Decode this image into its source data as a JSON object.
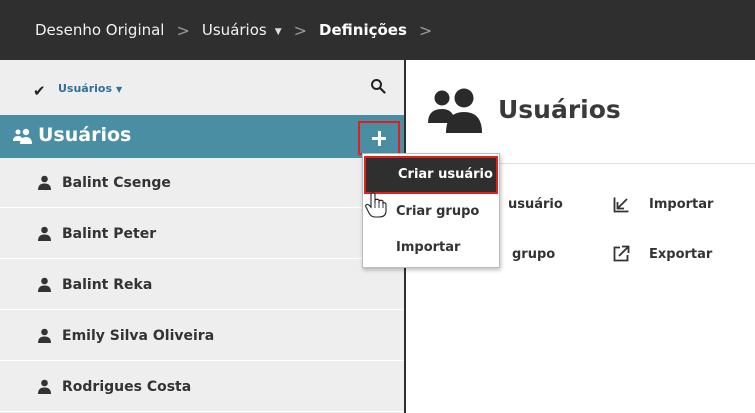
{
  "breadcrumb": {
    "items": [
      "Desenho Original",
      "Usuários",
      "Definições"
    ],
    "separator": ">"
  },
  "sidebar": {
    "filter_label": "Usuários",
    "group_title": "Usuários",
    "users": [
      "Balint Csenge",
      "Balint Peter",
      "Balint Reka",
      "Emily Silva Oliveira",
      "Rodrigues Costa"
    ]
  },
  "main": {
    "title": "Usuários",
    "actions": {
      "create_user_partial": "usuário",
      "import": "Importar",
      "create_group_partial": "grupo",
      "export": "Exportar"
    }
  },
  "dropdown": {
    "items": [
      "Criar usuário",
      "Criar grupo",
      "Importar"
    ]
  },
  "colors": {
    "topbar": "#2f2f2f",
    "accent": "#4a8ea4",
    "highlight_border": "#e02020",
    "link": "#2f6f9a"
  },
  "icons": {
    "filter": "checkmark-icon",
    "search": "search-icon",
    "group": "users-group-icon",
    "user": "user-icon",
    "import": "import-icon",
    "export": "export-icon"
  }
}
